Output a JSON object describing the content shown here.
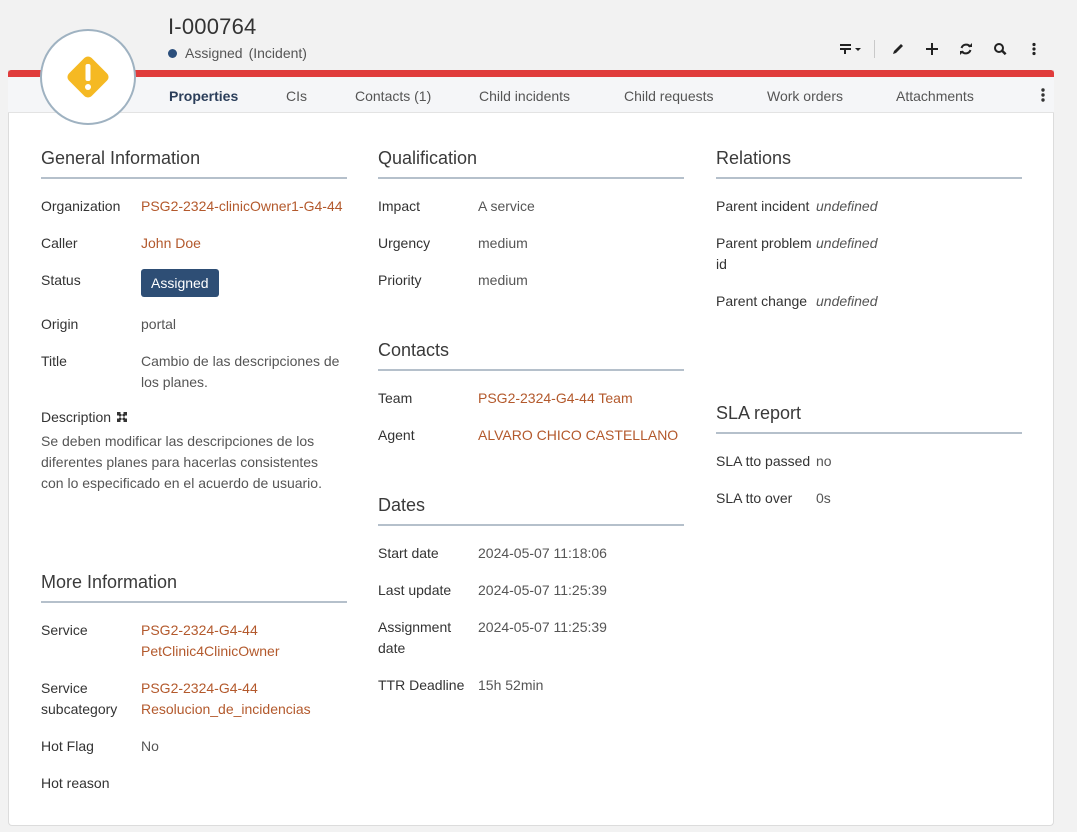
{
  "header": {
    "id": "I-000764",
    "status": "Assigned",
    "type": "(Incident)",
    "status_dot_color": "#2c4f7c",
    "accent_color": "#e03c3c",
    "badge_icon": "warning-diamond-icon",
    "badge_color": "#f5b923"
  },
  "toolbar": {
    "items": [
      "filter-dropdown-icon",
      "pencil-icon",
      "plus-icon",
      "refresh-icon",
      "search-icon",
      "more-vertical-icon"
    ]
  },
  "tabs": [
    {
      "label": "Properties",
      "active": true
    },
    {
      "label": "CIs"
    },
    {
      "label": "Contacts (1)"
    },
    {
      "label": "Child incidents"
    },
    {
      "label": "Child requests"
    },
    {
      "label": "Work orders"
    },
    {
      "label": "Attachments"
    }
  ],
  "general": {
    "title": "General Information",
    "organization_label": "Organization",
    "organization": "PSG2-2324-clinicOwner1-G4-44",
    "caller_label": "Caller",
    "caller": "John Doe",
    "status_label": "Status",
    "status": "Assigned",
    "origin_label": "Origin",
    "origin": "portal",
    "title_label": "Title",
    "title_value": "Cambio de las descripciones de los planes.",
    "description_label": "Description",
    "description": "Se deben modificar las descripciones de los diferentes planes para hacerlas consistentes con lo especificado en el acuerdo de usuario."
  },
  "more": {
    "title": "More Information",
    "service_label": "Service",
    "service": "PSG2-2324-G4-44 PetClinic4ClinicOwner",
    "subcategory_label": "Service subcategory",
    "subcategory": "PSG2-2324-G4-44 Resolucion_de_incidencias",
    "hotflag_label": "Hot Flag",
    "hotflag": "No",
    "hotreason_label": "Hot reason",
    "hotreason": ""
  },
  "qualification": {
    "title": "Qualification",
    "impact_label": "Impact",
    "impact": "A service",
    "urgency_label": "Urgency",
    "urgency": "medium",
    "priority_label": "Priority",
    "priority": "medium"
  },
  "contacts": {
    "title": "Contacts",
    "team_label": "Team",
    "team": "PSG2-2324-G4-44 Team",
    "agent_label": "Agent",
    "agent": "ALVARO CHICO CASTELLANO"
  },
  "dates": {
    "title": "Dates",
    "start_label": "Start date",
    "start": "2024-05-07 11:18:06",
    "update_label": "Last update",
    "update": "2024-05-07 11:25:39",
    "assign_label": "Assignment date",
    "assign": "2024-05-07 11:25:39",
    "ttr_label": "TTR Deadline",
    "ttr": "15h 52min"
  },
  "relations": {
    "title": "Relations",
    "parent_incident_label": "Parent incident",
    "parent_incident": "undefined",
    "parent_problem_label": "Parent problem id",
    "parent_problem": "undefined",
    "parent_change_label": "Parent change",
    "parent_change": "undefined"
  },
  "sla": {
    "title": "SLA report",
    "tto_passed_label": "SLA tto passed",
    "tto_passed": "no",
    "tto_over_label": "SLA tto over",
    "tto_over": "0s"
  }
}
